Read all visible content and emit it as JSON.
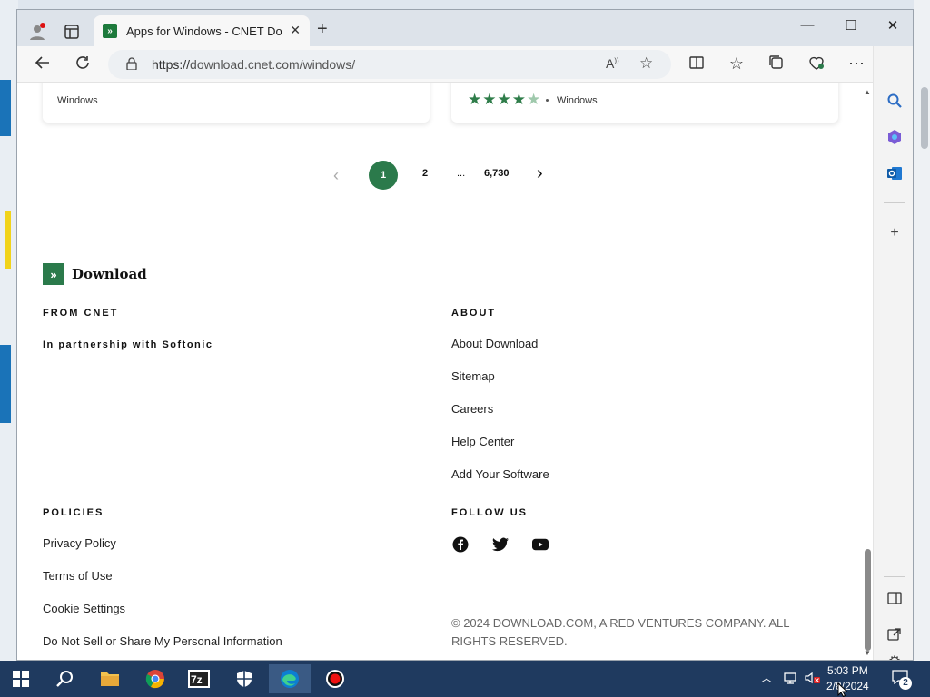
{
  "browser": {
    "tab_title": "Apps for Windows - CNET Download",
    "tab_close": "✕",
    "new_tab": "+",
    "url_prefix": "https://",
    "url": "download.cnet.com/windows/",
    "window_controls": {
      "minimize": "—",
      "maximize": "☐",
      "close": "✕"
    }
  },
  "cards": [
    {
      "os": "Windows"
    },
    {
      "rating": 4.5,
      "os": "Windows"
    }
  ],
  "pagination": {
    "prev": "‹",
    "current": "1",
    "second": "2",
    "ellipsis": "...",
    "last": "6,730",
    "next": "›"
  },
  "footer": {
    "logo_text": "Download",
    "from_cnet": {
      "heading": "FROM CNET",
      "partnership": "In partnership with Softonic"
    },
    "about": {
      "heading": "ABOUT",
      "links": [
        "About Download",
        "Sitemap",
        "Careers",
        "Help Center",
        "Add Your Software"
      ]
    },
    "policies": {
      "heading": "POLICIES",
      "links": [
        "Privacy Policy",
        "Terms of Use",
        "Cookie Settings",
        "Do Not Sell or Share My Personal Information"
      ]
    },
    "follow": {
      "heading": "FOLLOW US",
      "icons": [
        "facebook-icon",
        "twitter-icon",
        "youtube-icon"
      ]
    },
    "copyright": "© 2024 DOWNLOAD.COM, A RED VENTURES COMPANY. ALL RIGHTS RESERVED."
  },
  "taskbar": {
    "time": "5:03 PM",
    "date": "2/8/2024",
    "notification_count": "2",
    "apps": [
      "start",
      "search",
      "file-explorer",
      "chrome",
      "7zip",
      "security",
      "edge",
      "recorder"
    ]
  },
  "colors": {
    "brand_green": "#2b7a4b",
    "taskbar": "#1f3a5f"
  }
}
